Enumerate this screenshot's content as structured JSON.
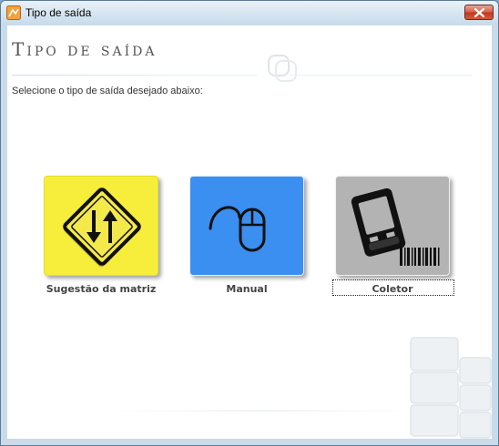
{
  "window": {
    "title": "Tipo de saída",
    "icon": "app-icon",
    "close_icon": "close-icon"
  },
  "page": {
    "title": "Tipo de saída",
    "subtitle": "Selecione o tipo de saída desejado abaixo:"
  },
  "options": [
    {
      "label": "Sugestão da matriz",
      "icon": "traffic-sign-arrows-icon",
      "color": "#f6ee3a"
    },
    {
      "label": "Manual",
      "icon": "mouse-icon",
      "color": "#3a8ff0"
    },
    {
      "label": "Coletor",
      "icon": "handheld-barcode-icon",
      "color": "#b3b3b3",
      "focused": true
    }
  ],
  "colors": {
    "title_text": "#555555",
    "frame": "#c9dbea",
    "close_button": "#c2381f"
  }
}
